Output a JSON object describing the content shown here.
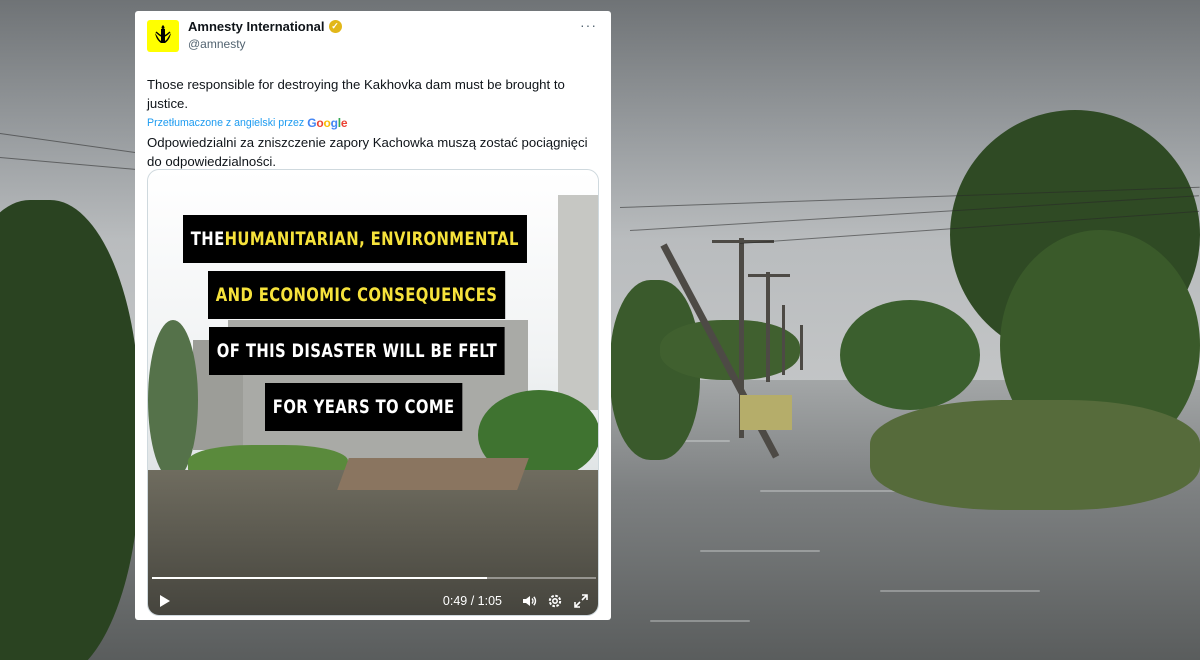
{
  "tweet": {
    "display_name": "Amnesty International",
    "handle": "@amnesty",
    "text": "Those responsible for destroying the Kakhovka dam must be brought to justice.",
    "translated_by": "Przetłumaczone z angielski przez",
    "translation_provider": "Google",
    "translated_text": "Odpowiedzialni za zniszczenie zapory Kachowka muszą zostać pociągnięci do odpowiedzialności."
  },
  "video": {
    "captions": [
      {
        "plain": "THE ",
        "highlight": "HUMANITARIAN, ENVIRONMENTAL",
        "rest": ""
      },
      {
        "plain": "",
        "highlight": "AND ECONOMIC CONSEQUENCES",
        "rest": ""
      },
      {
        "plain": "OF THIS DISASTER WILL BE FELT",
        "highlight": "",
        "rest": ""
      },
      {
        "plain": "FOR YEARS TO COME",
        "highlight": "",
        "rest": ""
      }
    ],
    "time_display": "0:49 / 1:05",
    "progress_fraction": 0.754
  },
  "colors": {
    "brand_yellow": "#ffff00",
    "caption_highlight": "#f6e23b",
    "verified_gold": "#e2b719",
    "link_blue": "#1d9bf0"
  },
  "icons": [
    "amnesty-candle-icon",
    "verified-badge-icon",
    "more-options-icon",
    "play-icon",
    "volume-icon",
    "settings-gear-icon",
    "fullscreen-icon"
  ]
}
